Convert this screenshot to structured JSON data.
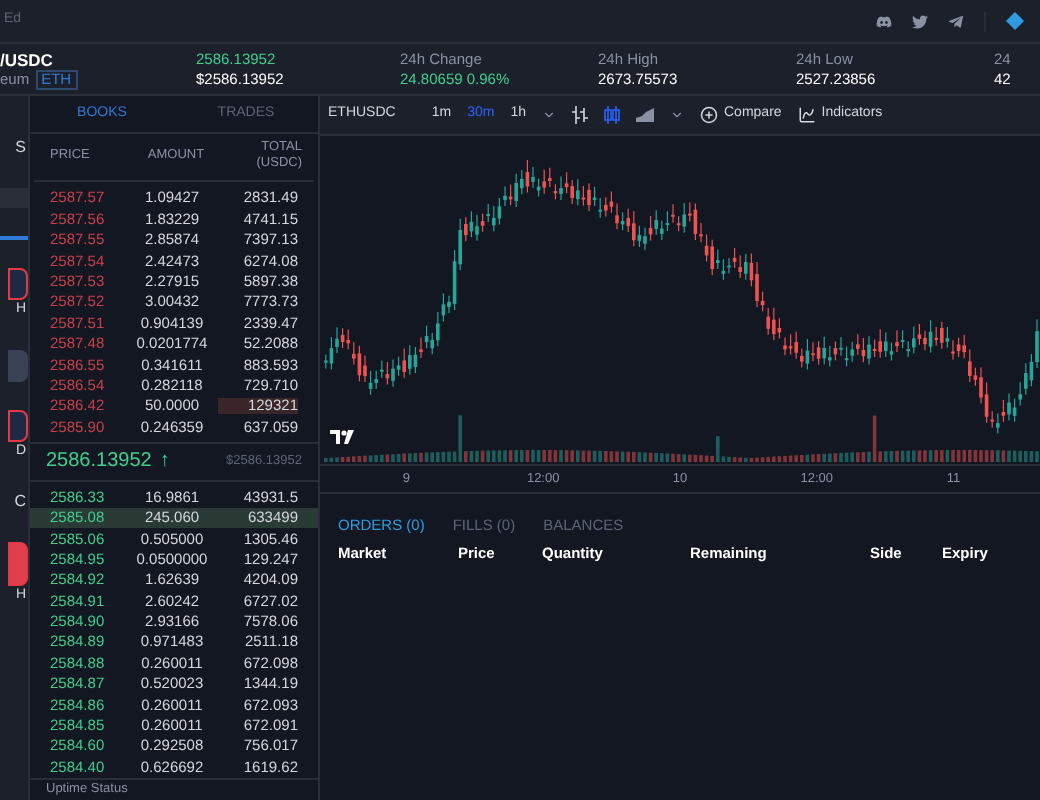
{
  "top_bar": {
    "left_text": "Ed"
  },
  "ticker": {
    "pair": "/USDC",
    "name": "eum",
    "symbol": "ETH",
    "price": "2586.13952",
    "price_usd": "$2586.13952",
    "stats": [
      {
        "label": "24h Change",
        "value": "24.80659 0.96%",
        "positive": true
      },
      {
        "label": "24h High",
        "value": "2673.75573",
        "positive": false
      },
      {
        "label": "24h Low",
        "value": "2527.23856",
        "positive": false
      },
      {
        "label": "24",
        "value": "42",
        "positive": false
      }
    ]
  },
  "sidebar": {
    "items": [
      {
        "kind": "text",
        "label": "S"
      },
      {
        "kind": "highlight"
      },
      {
        "kind": "line"
      },
      {
        "kind": "outlined",
        "label": "H"
      },
      {
        "kind": "plain"
      },
      {
        "kind": "outlined",
        "label": "D"
      },
      {
        "kind": "text",
        "label": "C"
      },
      {
        "kind": "filled",
        "label": "H"
      }
    ]
  },
  "order_book": {
    "tabs": [
      {
        "label": "BOOKS",
        "selected": true
      },
      {
        "label": "TRADES",
        "selected": false
      }
    ],
    "columns": [
      "PRICE",
      "AMOUNT",
      "TOTAL (USDC)"
    ],
    "asks": [
      {
        "price": "2587.57",
        "amount": "1.09427",
        "total": "2831.49",
        "highlighted": false
      },
      {
        "price": "2587.56",
        "amount": "1.83229",
        "total": "4741.15",
        "highlighted": false
      },
      {
        "price": "2587.55",
        "amount": "2.85874",
        "total": "7397.13",
        "highlighted": false
      },
      {
        "price": "2587.54",
        "amount": "2.42473",
        "total": "6274.08",
        "highlighted": false
      },
      {
        "price": "2587.53",
        "amount": "2.27915",
        "total": "5897.38",
        "highlighted": false
      },
      {
        "price": "2587.52",
        "amount": "3.00432",
        "total": "7773.73",
        "highlighted": false
      },
      {
        "price": "2587.51",
        "amount": "0.904139",
        "total": "2339.47",
        "highlighted": false
      },
      {
        "price": "2587.48",
        "amount": "0.0201774",
        "total": "52.2088",
        "highlighted": false
      },
      {
        "price": "2586.55",
        "amount": "0.341611",
        "total": "883.593",
        "highlighted": false
      },
      {
        "price": "2586.54",
        "amount": "0.282118",
        "total": "729.710",
        "highlighted": false
      },
      {
        "price": "2586.42",
        "amount": "50.0000",
        "total": "129321",
        "highlighted": true
      },
      {
        "price": "2585.90",
        "amount": "0.246359",
        "total": "637.059",
        "highlighted": false
      }
    ],
    "mid_price": "2586.13952",
    "mid_arrow": "↑",
    "mid_usd": "$2586.13952",
    "bids": [
      {
        "price": "2586.33",
        "amount": "16.9861",
        "total": "43931.5",
        "highlighted": false
      },
      {
        "price": "2585.08",
        "amount": "245.060",
        "total": "633499",
        "highlighted": true
      },
      {
        "price": "2585.06",
        "amount": "0.505000",
        "total": "1305.46",
        "highlighted": false
      },
      {
        "price": "2584.95",
        "amount": "0.0500000",
        "total": "129.247",
        "highlighted": false
      },
      {
        "price": "2584.92",
        "amount": "1.62639",
        "total": "4204.09",
        "highlighted": false
      },
      {
        "price": "2584.91",
        "amount": "2.60242",
        "total": "6727.02",
        "highlighted": false
      },
      {
        "price": "2584.90",
        "amount": "2.93166",
        "total": "7578.06",
        "highlighted": false
      },
      {
        "price": "2584.89",
        "amount": "0.971483",
        "total": "2511.18",
        "highlighted": false
      },
      {
        "price": "2584.88",
        "amount": "0.260011",
        "total": "672.098",
        "highlighted": false
      },
      {
        "price": "2584.87",
        "amount": "0.520023",
        "total": "1344.19",
        "highlighted": false
      },
      {
        "price": "2584.86",
        "amount": "0.260011",
        "total": "672.093",
        "highlighted": false
      },
      {
        "price": "2584.85",
        "amount": "0.260011",
        "total": "672.091",
        "highlighted": false
      },
      {
        "price": "2584.60",
        "amount": "0.292508",
        "total": "756.017",
        "highlighted": false
      },
      {
        "price": "2584.40",
        "amount": "0.626692",
        "total": "1619.62",
        "highlighted": false
      }
    ]
  },
  "chart": {
    "symbol": "ETHUSDC",
    "intervals": [
      {
        "label": "1m",
        "selected": false
      },
      {
        "label": "30m",
        "selected": true
      },
      {
        "label": "1h",
        "selected": false
      }
    ],
    "compare": "Compare",
    "indicators": "Indicators",
    "x_labels": [
      "9",
      "12:00",
      "10",
      "12:00",
      "11"
    ]
  },
  "orders": {
    "tabs": [
      {
        "label": "ORDERS (0)",
        "selected": true
      },
      {
        "label": "FILLS (0)",
        "selected": false
      },
      {
        "label": "BALANCES",
        "selected": false
      }
    ],
    "columns": [
      "Market",
      "Price",
      "Quantity",
      "Remaining",
      "Side",
      "Expiry"
    ]
  },
  "status_bar": {
    "text": "Uptime Status"
  }
}
